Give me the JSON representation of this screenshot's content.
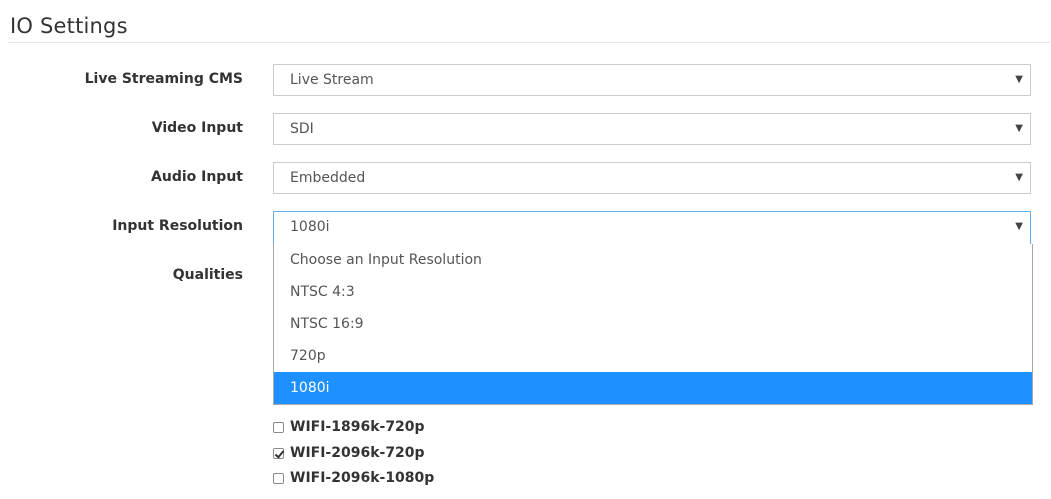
{
  "header": {
    "title": "IO Settings"
  },
  "form": {
    "live_streaming_cms": {
      "label": "Live Streaming CMS",
      "value": "Live Stream"
    },
    "video_input": {
      "label": "Video Input",
      "value": "SDI"
    },
    "audio_input": {
      "label": "Audio Input",
      "value": "Embedded"
    },
    "input_resolution": {
      "label": "Input Resolution",
      "value": "1080i",
      "options": [
        "Choose an Input Resolution",
        "NTSC 4:3",
        "NTSC 16:9",
        "720p",
        "1080i"
      ],
      "selected_index": 4
    },
    "qualities": {
      "label": "Qualities",
      "items": [
        {
          "label": "WIFI-1896k-720p",
          "checked": false
        },
        {
          "label": "WIFI-2096k-720p",
          "checked": true
        },
        {
          "label": "WIFI-2096k-1080p",
          "checked": false
        }
      ]
    }
  },
  "icons": {
    "caret": "caret-down-icon",
    "check": "checkmark-icon"
  },
  "colors": {
    "highlight": "#1e90ff",
    "focus_border": "#66afe9"
  }
}
